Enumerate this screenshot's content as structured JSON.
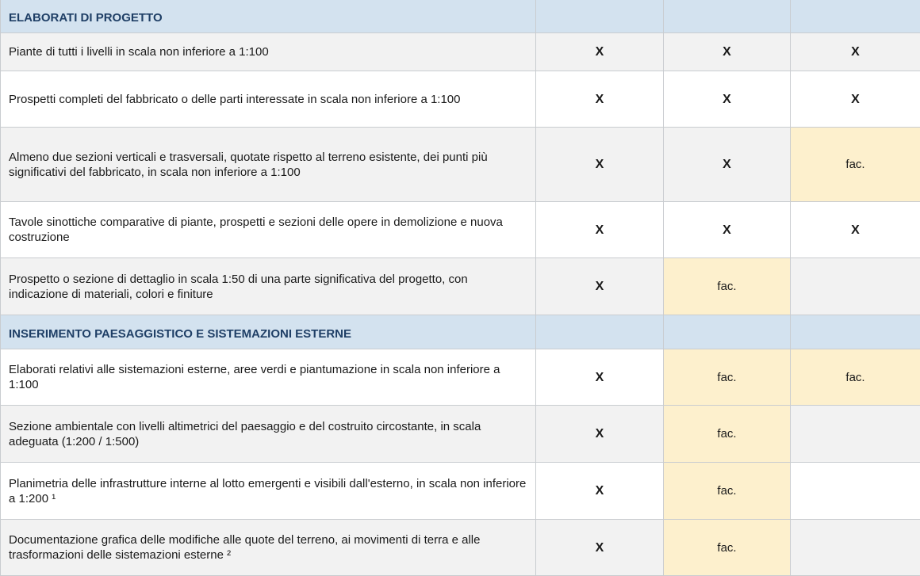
{
  "sections": [
    {
      "title": "ELABORATI DI PROGETTO",
      "rows": [
        {
          "desc": "Piante di tutti i livelli in scala non inferiore a 1:100",
          "cols": [
            "X",
            "X",
            "X"
          ]
        },
        {
          "desc": "Prospetti completi del fabbricato o delle parti interessate in scala non inferiore a 1:100",
          "cols": [
            "X",
            "X",
            "X"
          ]
        },
        {
          "desc": "Almeno due sezioni verticali e trasversali, quotate rispetto al terreno esistente, dei punti più significativi del fabbricato, in scala non inferiore a 1:100",
          "cols": [
            "X",
            "X",
            "fac."
          ]
        },
        {
          "desc": "Tavole sinottiche comparative di piante, prospetti e sezioni delle opere in demolizione e nuova costruzione",
          "cols": [
            "X",
            "X",
            "X"
          ]
        },
        {
          "desc": "Prospetto o sezione di dettaglio in scala 1:50 di una parte significativa del progetto, con indicazione di materiali, colori e finiture",
          "cols": [
            "X",
            "fac.",
            ""
          ]
        }
      ]
    },
    {
      "title": "INSERIMENTO PAESAGGISTICO E SISTEMAZIONI ESTERNE",
      "rows": [
        {
          "desc": "Elaborati relativi alle sistemazioni esterne, aree verdi e piantumazione in scala non inferiore a 1:100",
          "cols": [
            "X",
            "fac.",
            "fac."
          ]
        },
        {
          "desc": "Sezione ambientale con livelli altimetrici del paesaggio e del costruito circostante, in scala adeguata (1:200 / 1:500)",
          "cols": [
            "X",
            "fac.",
            ""
          ]
        },
        {
          "desc": "Planimetria delle infrastrutture interne al lotto emergenti e visibili dall'esterno, in scala non inferiore a 1:200 ¹",
          "cols": [
            "X",
            "fac.",
            ""
          ]
        },
        {
          "desc": "Documentazione grafica delle modifiche alle quote del terreno, ai movimenti di terra e alle trasformazioni delle sistemazioni esterne ²",
          "cols": [
            "X",
            "fac.",
            ""
          ]
        }
      ]
    }
  ],
  "colors": {
    "section_bg": "#d3e2ef",
    "section_text": "#1f3f66",
    "fac_bg": "#fdf0cd",
    "row_alt_bg": "#f2f2f2",
    "border": "#c9ccd0"
  }
}
